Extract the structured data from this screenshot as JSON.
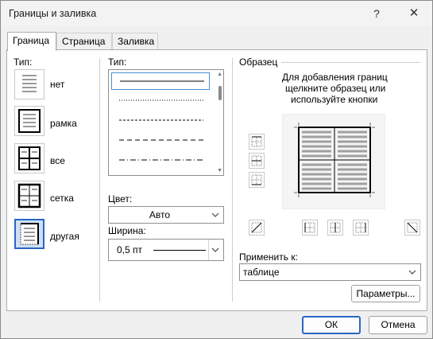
{
  "window": {
    "title": "Границы и заливка",
    "help_glyph": "?",
    "close_glyph": "✕"
  },
  "tabs": [
    {
      "label": "Граница",
      "active": true
    },
    {
      "label": "Страница",
      "active": false
    },
    {
      "label": "Заливка",
      "active": false
    }
  ],
  "setting": {
    "label": "Тип:",
    "options": [
      {
        "label": "нет",
        "icon": "border-none-icon"
      },
      {
        "label": "рамка",
        "icon": "border-box-icon"
      },
      {
        "label": "все",
        "icon": "border-all-icon"
      },
      {
        "label": "сетка",
        "icon": "border-grid-icon"
      },
      {
        "label": "другая",
        "icon": "border-custom-icon"
      }
    ],
    "selected": "другая"
  },
  "style": {
    "label": "Тип:",
    "line_styles": [
      "solid",
      "dotted",
      "dashed-small",
      "dashed",
      "dash-dot"
    ],
    "selected": "solid"
  },
  "color": {
    "label": "Цвет:",
    "value": "Авто"
  },
  "width": {
    "label": "Ширина:",
    "value": "0,5 пт"
  },
  "preview": {
    "label": "Образец",
    "hint_line1": "Для добавления границ",
    "hint_line2": "щелкните образец или",
    "hint_line3": "используйте кнопки"
  },
  "apply_to": {
    "label": "Применить к:",
    "value": "таблице"
  },
  "buttons": {
    "options": "Параметры...",
    "ok": "ОК",
    "cancel": "Отмена"
  },
  "colors": {
    "accent": "#2b66c3",
    "selected_bg": "#cde0f7"
  }
}
